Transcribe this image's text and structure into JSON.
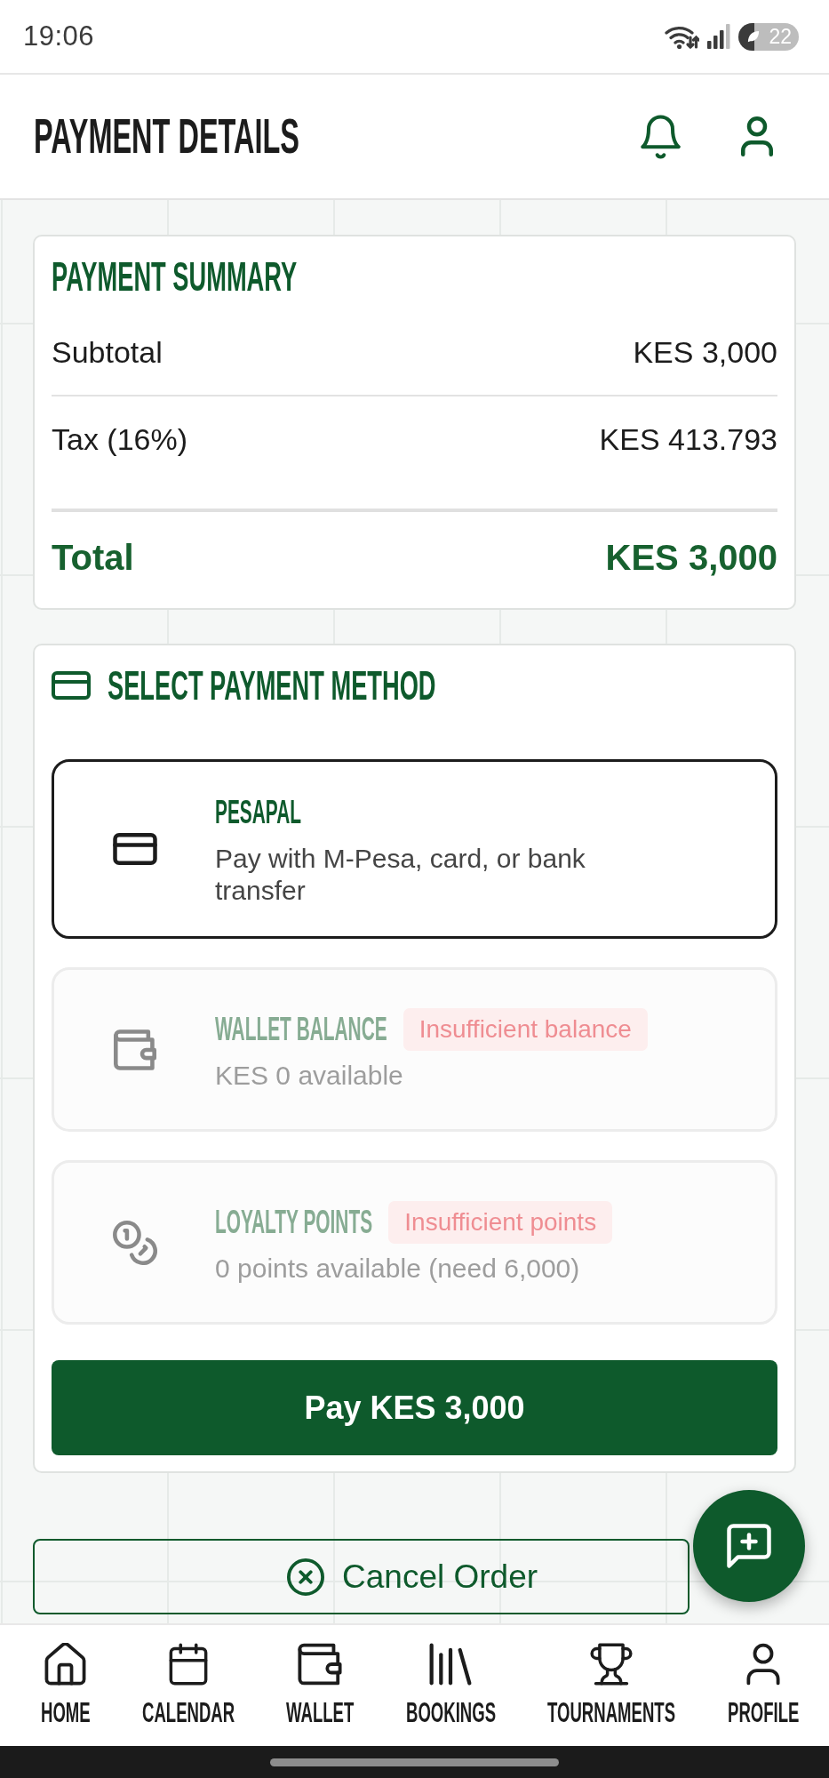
{
  "status_bar": {
    "time": "19:06",
    "battery": "22"
  },
  "header": {
    "title": "PAYMENT DETAILS"
  },
  "summary": {
    "title": "PAYMENT SUMMARY",
    "rows": [
      {
        "kind": "line",
        "label": "Subtotal",
        "value": "KES 3,000"
      },
      {
        "kind": "line",
        "label": "Tax (16%)",
        "value": "KES 413.793"
      },
      {
        "kind": "total",
        "label": "Total",
        "value": "KES 3,000"
      }
    ]
  },
  "payment_methods": {
    "title": "SELECT PAYMENT METHOD",
    "options": [
      {
        "kind": "card",
        "name": "PESAPAL",
        "description": "Pay with M-Pesa, card, or bank transfer",
        "selected": true,
        "disabled": false
      },
      {
        "kind": "wallet",
        "name": "WALLET BALANCE",
        "badge": "Insufficient balance",
        "description": "KES 0 available",
        "selected": false,
        "disabled": true
      },
      {
        "kind": "coins",
        "name": "LOYALTY POINTS",
        "badge": "Insufficient points",
        "description": "0 points available (need 6,000)",
        "selected": false,
        "disabled": true
      }
    ],
    "pay_button": "Pay KES 3,000"
  },
  "cancel_button": "Cancel Order",
  "bottom_nav": [
    {
      "kind": "home",
      "label": "HOME",
      "selected": false
    },
    {
      "kind": "calendar",
      "label": "CALENDAR",
      "selected": false
    },
    {
      "kind": "wallet",
      "label": "WALLET",
      "selected": false
    },
    {
      "kind": "books",
      "label": "BOOKINGS",
      "selected": false
    },
    {
      "kind": "trophy",
      "label": "TOURNAMENTS",
      "selected": false
    },
    {
      "kind": "person",
      "label": "PROFILE",
      "selected": false
    }
  ]
}
